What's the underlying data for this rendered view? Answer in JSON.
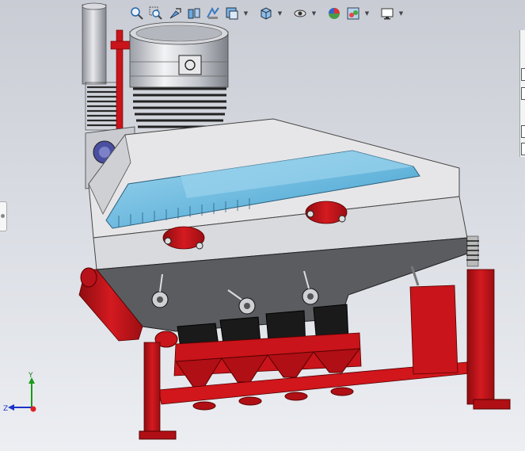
{
  "toolbar": {
    "items": [
      {
        "name": "zoom-to-fit-icon"
      },
      {
        "name": "zoom-to-area-icon"
      },
      {
        "name": "previous-view-icon"
      },
      {
        "name": "section-view-icon"
      },
      {
        "name": "dynamic-annotation-icon"
      },
      {
        "name": "view-orientation-icon",
        "caret": true
      },
      {
        "name": "display-style-icon",
        "caret": true
      },
      {
        "name": "hide-show-items-icon",
        "caret": true
      },
      {
        "name": "edit-appearance-icon"
      },
      {
        "name": "apply-scene-icon",
        "caret": true
      },
      {
        "name": "view-settings-icon",
        "caret": true
      }
    ]
  },
  "triad": {
    "y_label": "Y",
    "z_label": "Z"
  },
  "colors": {
    "frame_red": "#c8141a",
    "body_grey": "#5a5c60",
    "panel_light": "#e6e6e8",
    "window_blue": "#7ec8ea"
  }
}
